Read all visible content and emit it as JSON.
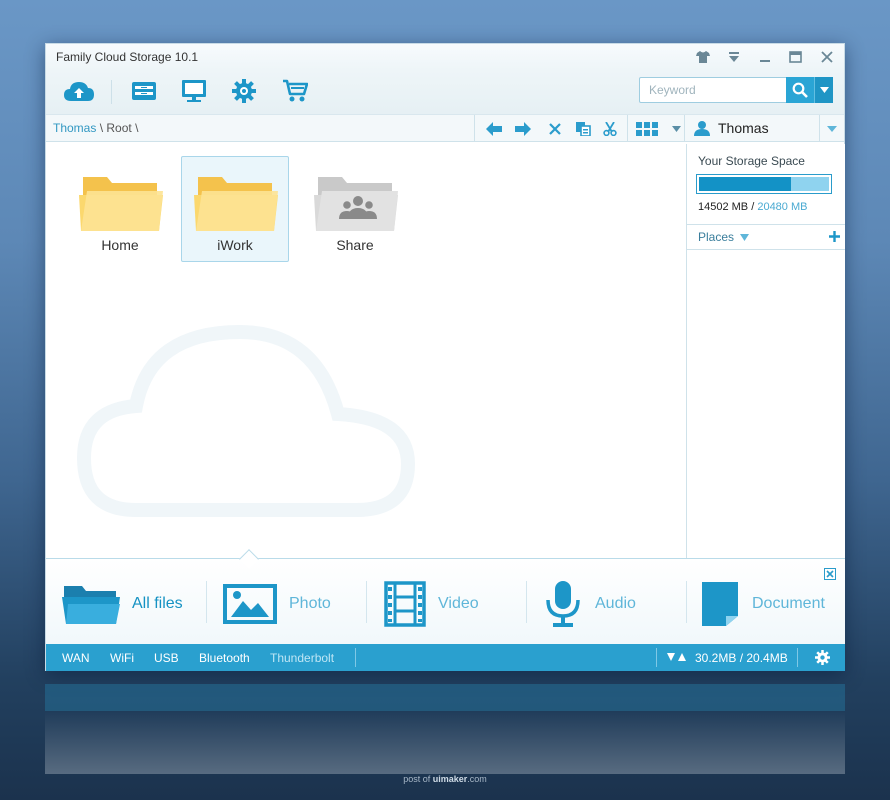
{
  "window": {
    "title": "Family Cloud Storage 10.1"
  },
  "search": {
    "placeholder": "Keyword"
  },
  "breadcrumb": {
    "user": "Thomas",
    "sep1": " \\ ",
    "root": "Root",
    "sep2": " \\"
  },
  "account": {
    "username": "Thomas"
  },
  "folders": [
    {
      "label": "Home",
      "selected": false
    },
    {
      "label": "iWork",
      "selected": true
    },
    {
      "label": "Share",
      "selected": false
    }
  ],
  "storage": {
    "title": "Your Storage Space",
    "used": "14502 MB",
    "separator": " / ",
    "total": "20480 MB",
    "used_fraction": 0.708
  },
  "places": {
    "label": "Places"
  },
  "categories": [
    {
      "label": "All files",
      "active": true
    },
    {
      "label": "Photo",
      "active": false
    },
    {
      "label": "Video",
      "active": false
    },
    {
      "label": "Audio",
      "active": false
    },
    {
      "label": "Document",
      "active": false
    }
  ],
  "status": {
    "connections": [
      "WAN",
      "WiFi",
      "USB",
      "Bluetooth",
      "Thunderbolt"
    ],
    "transfer": "30.2MB / 20.4MB"
  },
  "colors": {
    "accent": "#2aa0cf",
    "active_text": "#1592c3",
    "inactive_text": "#5fb6d9",
    "folder": "#fbd86e",
    "share_folder": "#d9d9d9"
  },
  "credit": {
    "prefix": "post of ",
    "site": "uimaker",
    "suffix": ".com"
  }
}
